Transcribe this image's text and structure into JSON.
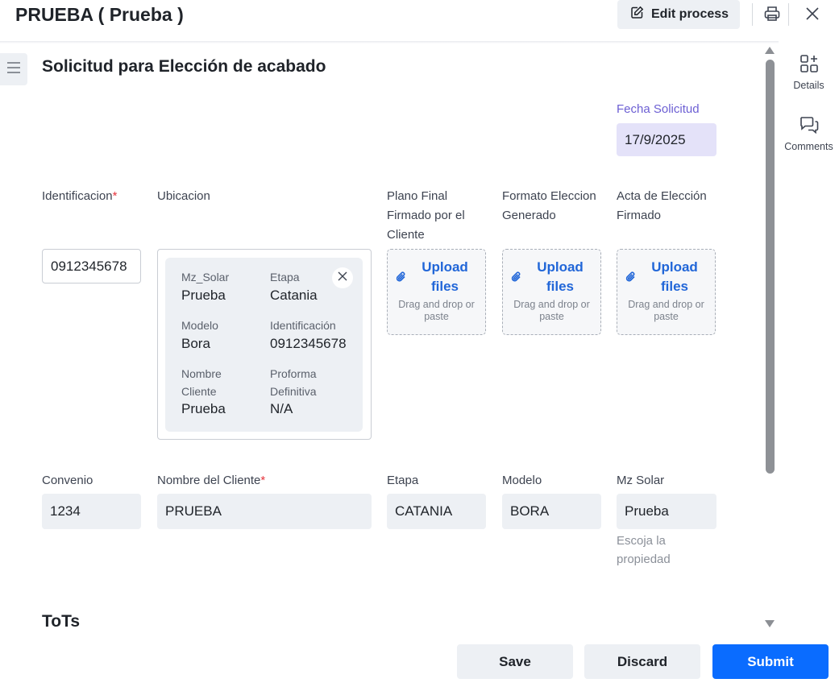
{
  "header": {
    "title": "PRUEBA ( Prueba )",
    "edit_label": "Edit process"
  },
  "form": {
    "section_title": "Solicitud para Elección de acabado",
    "fecha_label": "Fecha Solicitud",
    "fecha_value": "17/9/2025",
    "identificacion_label": "Identificacion",
    "identificacion_value": "0912345678",
    "ubicacion_label": "Ubicacion",
    "plano_label": "Plano Final Firmado por el Cliente",
    "formato_label": "Formato Eleccion Generado",
    "acta_label": "Acta de Elección Firmado",
    "convenio_label": "Convenio",
    "convenio_value": "1234",
    "nombre_label": "Nombre del Cliente",
    "nombre_value": "PRUEBA",
    "etapa_label": "Etapa",
    "etapa_value": "CATANIA",
    "modelo_label": "Modelo",
    "modelo_value": "BORA",
    "mz_label": "Mz Solar",
    "mz_value": "Prueba",
    "mz_helper": "Escoja la propiedad",
    "required_mark": "*"
  },
  "ubicacion_card": {
    "mz_solar_k": "Mz_Solar",
    "mz_solar_v": "Prueba",
    "etapa_k": "Etapa",
    "etapa_v": "Catania",
    "modelo_k": "Modelo",
    "modelo_v": "Bora",
    "ident_k": "Identificación",
    "ident_v": "0912345678",
    "nombre_k": "Nombre Cliente",
    "nombre_v": "Prueba",
    "proforma_k": "Proforma Definitiva",
    "proforma_v": "N/A"
  },
  "upload": {
    "title": "Upload files",
    "subtitle": "Drag and drop or paste"
  },
  "tots_title": "ToTs",
  "sidebar": {
    "details_label": "Details",
    "comments_label": "Comments"
  },
  "footer": {
    "save_label": "Save",
    "discard_label": "Discard",
    "submit_label": "Submit"
  },
  "colors": {
    "accent": "#0a6cff",
    "link": "#2166d8",
    "purple_label": "#6c5fd3",
    "required": "#e5343d"
  },
  "icons": [
    "edit-icon",
    "print-icon",
    "close-icon",
    "menu-icon",
    "details-icon",
    "comments-icon",
    "paperclip-icon"
  ]
}
